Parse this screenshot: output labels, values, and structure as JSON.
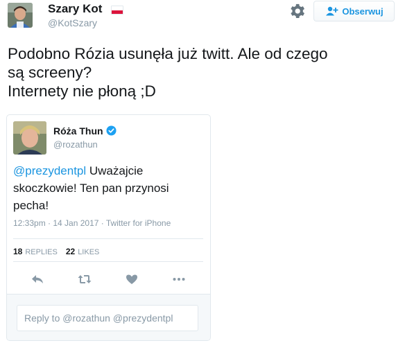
{
  "author": {
    "name": "Szary Kot",
    "handle": "@KotSzary",
    "flag": "poland-flag-icon",
    "avatar": "avatar"
  },
  "header": {
    "settings_icon": "gear-icon",
    "follow_label": "Obserwuj",
    "follow_icon": "add-user-icon"
  },
  "tweet": {
    "lines": [
      "Podobno Rózia usunęła już twitt. Ale od czego",
      "są screeny?",
      "Internety nie płoną ;D"
    ]
  },
  "embedded": {
    "name": "Róża Thun",
    "handle": "@rozathun",
    "verified_icon": "verified-badge-icon",
    "mention": "@prezydentpl",
    "text": " Uważajcie skoczkowie! Ten pan przynosi pecha!",
    "meta": "12:33pm · 14 Jan 2017 · Twitter for iPhone",
    "stats": {
      "replies_count": "18",
      "replies_label": "REPLIES",
      "likes_count": "22",
      "likes_label": "LIKES"
    },
    "actions": [
      "reply-icon",
      "retweet-icon",
      "like-heart-icon",
      "more-dots-icon"
    ],
    "reply_placeholder": "Reply to @rozathun @prezydentpl"
  },
  "colors": {
    "link": "#1b95e0",
    "muted": "#8899a6",
    "text": "#14171a",
    "border": "#e1e8ed",
    "flag_red": "#dc143c"
  }
}
